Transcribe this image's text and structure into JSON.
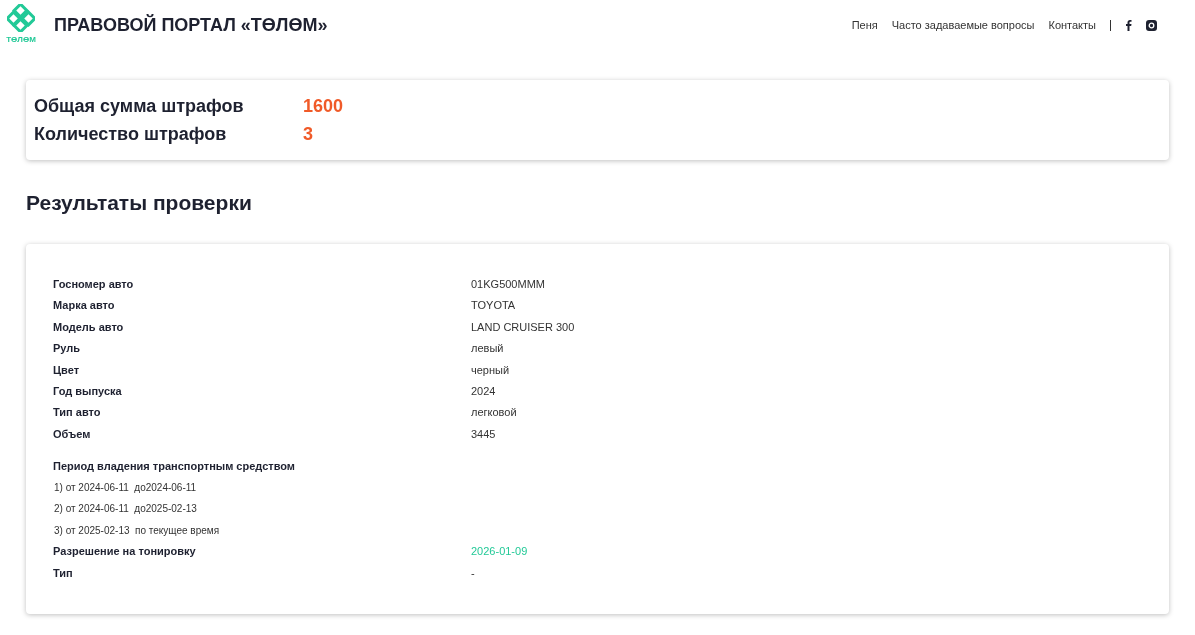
{
  "header": {
    "logo_text": "ТӨЛӨМ",
    "title": "ПРАВОВОЙ ПОРТАЛ «ТӨЛӨМ»",
    "nav": [
      "Пеня",
      "Часто задаваемые вопросы",
      "Контакты"
    ]
  },
  "summary": [
    {
      "label": "Общая сумма штрафов",
      "value": "1600"
    },
    {
      "label": "Количество штрафов",
      "value": "3"
    }
  ],
  "results_title": "Результаты проверки",
  "details": [
    {
      "label": "Госномер авто",
      "value": "01KG500MMM"
    },
    {
      "label": "Марка авто",
      "value": "TOYOTA"
    },
    {
      "label": "Модель авто",
      "value": "LAND CRUISER 300"
    },
    {
      "label": "Руль",
      "value": "левый"
    },
    {
      "label": "Цвет",
      "value": "черный"
    },
    {
      "label": "Год выпуска",
      "value": "2024"
    },
    {
      "label": "Тип авто",
      "value": "легковой"
    },
    {
      "label": "Объем",
      "value": "3445"
    }
  ],
  "ownership": {
    "title": "Период владения транспортным средством",
    "periods": [
      "1) от 2024-06-11  до2024-06-11",
      "2) от 2024-06-11  до2025-02-13",
      "3) от 2025-02-13  по текущее время"
    ]
  },
  "extra": [
    {
      "label": "Разрешение на тонировку",
      "value": "2026-01-09",
      "color": "#22c997"
    },
    {
      "label": "Тип",
      "value": "-"
    }
  ]
}
